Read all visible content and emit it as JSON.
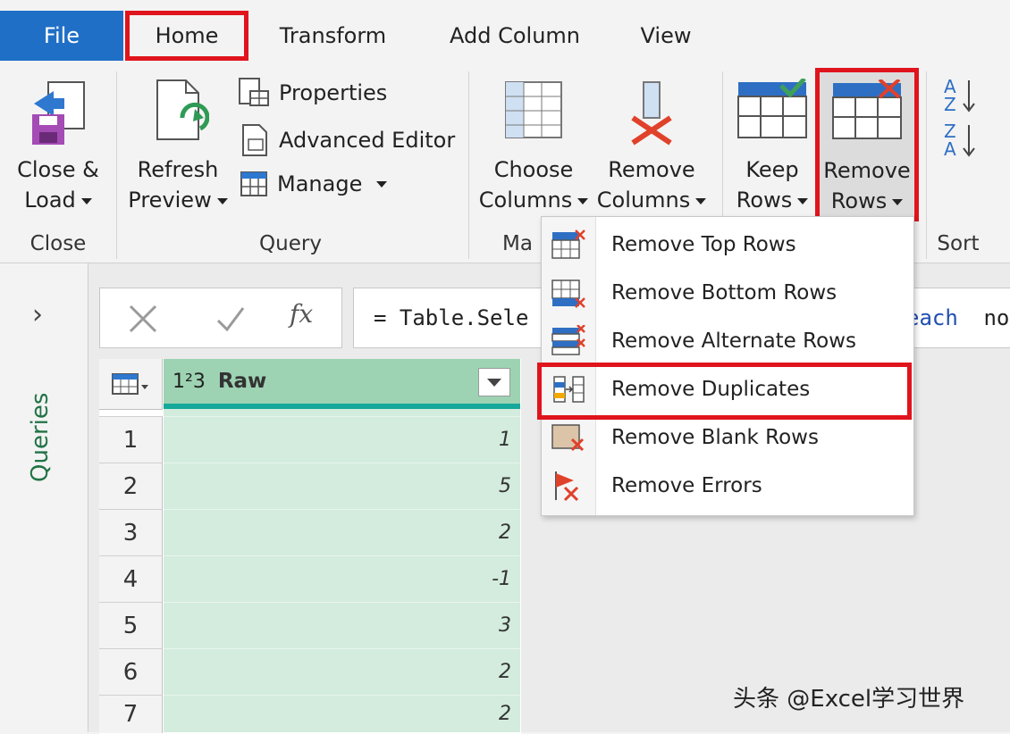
{
  "tabs": {
    "file": "File",
    "home": "Home",
    "transform": "Transform",
    "add_column": "Add Column",
    "view": "View"
  },
  "ribbon": {
    "close_load": [
      "Close &",
      "Load"
    ],
    "refresh_preview": [
      "Refresh",
      "Preview"
    ],
    "properties": "Properties",
    "advanced_editor": "Advanced Editor",
    "manage": "Manage",
    "choose_columns": [
      "Choose",
      "Columns"
    ],
    "remove_columns": [
      "Remove",
      "Columns"
    ],
    "keep_rows": [
      "Keep",
      "Rows"
    ],
    "remove_rows": [
      "Remove",
      "Rows"
    ],
    "groups": {
      "close": "Close",
      "query": "Query",
      "manage_partial": "Ma",
      "sort": "Sort"
    }
  },
  "left_pane": {
    "queries": "Queries"
  },
  "formula": {
    "fx": "fx",
    "prefix": "= Table.Sele",
    "suffix_keyword": "each",
    "suffix_rest": " not"
  },
  "grid": {
    "column_header": "Raw",
    "type_icon": "1²3",
    "rows": [
      {
        "n": "1",
        "v": "1"
      },
      {
        "n": "2",
        "v": "5"
      },
      {
        "n": "3",
        "v": "2"
      },
      {
        "n": "4",
        "v": "-1"
      },
      {
        "n": "5",
        "v": "3"
      },
      {
        "n": "6",
        "v": "2"
      },
      {
        "n": "7",
        "v": "2"
      }
    ]
  },
  "menu": {
    "items": [
      {
        "label": "Remove Top Rows",
        "icon": "remove-top-rows-icon"
      },
      {
        "label": "Remove Bottom Rows",
        "icon": "remove-bottom-rows-icon"
      },
      {
        "label": "Remove Alternate Rows",
        "icon": "remove-alternate-rows-icon"
      },
      {
        "label": "Remove Duplicates",
        "icon": "remove-duplicates-icon"
      },
      {
        "label": "Remove Blank Rows",
        "icon": "remove-blank-rows-icon"
      },
      {
        "label": "Remove Errors",
        "icon": "remove-errors-icon"
      }
    ]
  },
  "watermark": "头条 @Excel学习世界",
  "colors": {
    "accent": "#1f6fc6",
    "highlight": "#e0141c",
    "grid_fill": "#d3ecdd",
    "header_fill": "#9dd3b3"
  }
}
